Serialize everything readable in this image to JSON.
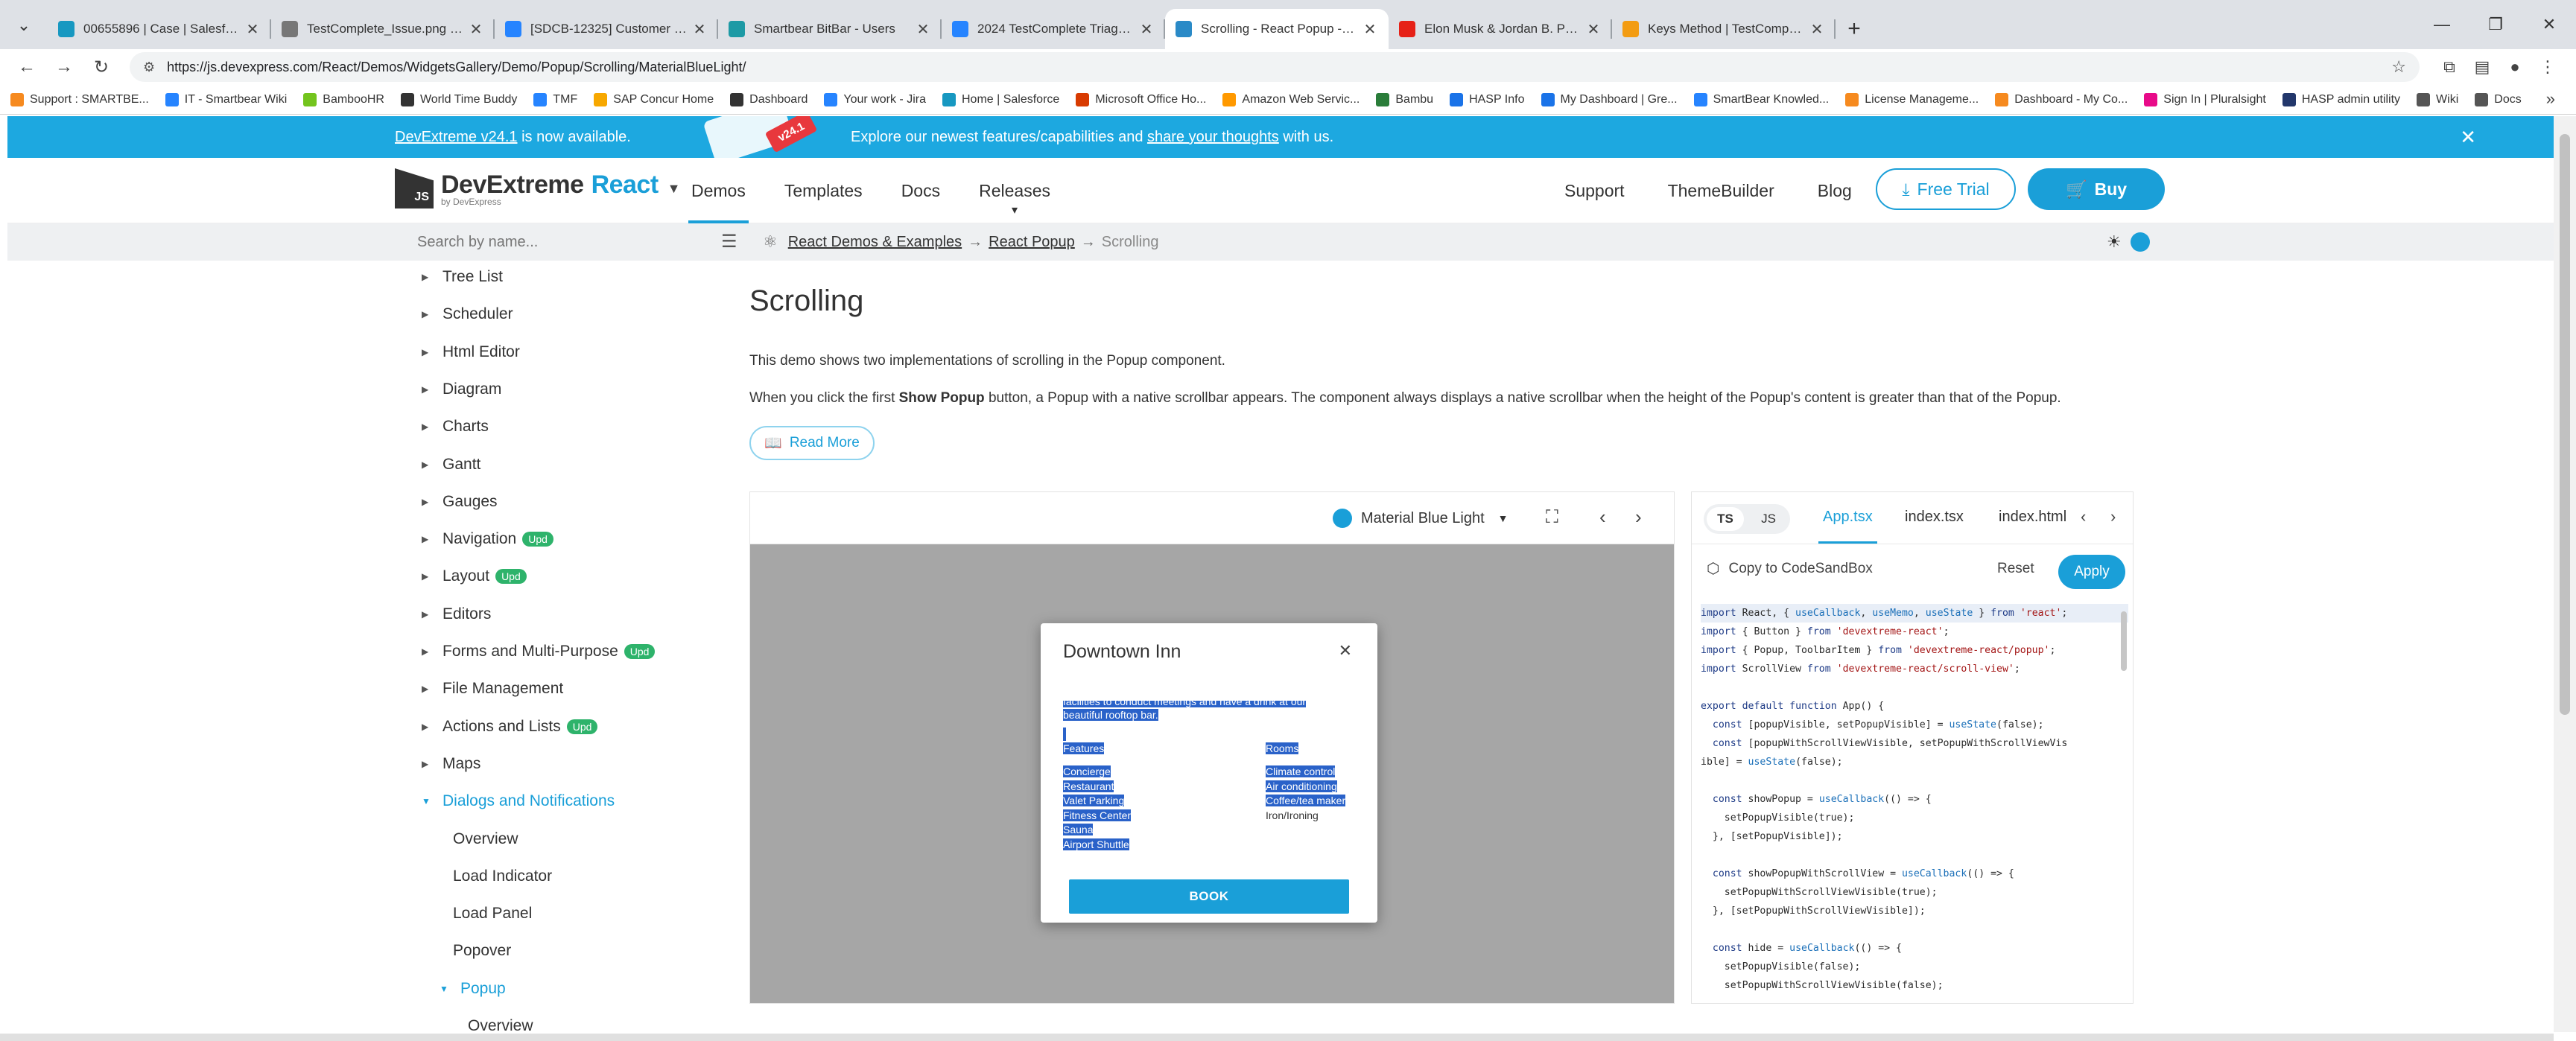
{
  "browser": {
    "tabs": [
      {
        "title": "00655896 | Case | Salesforce",
        "color": "#1798c1",
        "active": false
      },
      {
        "title": "TestComplete_Issue.png (3840×",
        "color": "#777777",
        "active": false
      },
      {
        "title": "[SDCB-12325] Customer is askin",
        "color": "#2684ff",
        "active": false
      },
      {
        "title": "Smartbear BitBar - Users",
        "color": "#1d9aa5",
        "active": false
      },
      {
        "title": "2024 TestComplete Triage - Con",
        "color": "#2684ff",
        "active": false
      },
      {
        "title": "Scrolling - React Popup - DevEx",
        "color": "#2a8ac7",
        "active": true
      },
      {
        "title": "Elon Musk & Jordan B. Peterson",
        "color": "#e62117",
        "active": false
      },
      {
        "title": "Keys Method | TestComplete Do",
        "color": "#f39c12",
        "active": false
      }
    ],
    "new_tab": "+",
    "url": "https://js.devexpress.com/React/Demos/WidgetsGallery/Demo/Popup/Scrolling/MaterialBlueLight/",
    "bookmarks": [
      {
        "label": "Support : SMARTBE...",
        "color": "#f68a1f"
      },
      {
        "label": "IT - Smartbear Wiki",
        "color": "#2684ff"
      },
      {
        "label": "BambooHR",
        "color": "#73c41d"
      },
      {
        "label": "World Time Buddy",
        "color": "#333333"
      },
      {
        "label": "TMF",
        "color": "#2684ff"
      },
      {
        "label": "SAP Concur Home",
        "color": "#f7a800"
      },
      {
        "label": "Dashboard",
        "color": "#333333"
      },
      {
        "label": "Your work - Jira",
        "color": "#2684ff"
      },
      {
        "label": "Home | Salesforce",
        "color": "#1798c1"
      },
      {
        "label": "Microsoft Office Ho...",
        "color": "#d83b01"
      },
      {
        "label": "Amazon Web Servic...",
        "color": "#ff9900"
      },
      {
        "label": "Bambu",
        "color": "#2a7d3a"
      },
      {
        "label": "HASP Info",
        "color": "#1a73e8"
      },
      {
        "label": "My Dashboard | Gre...",
        "color": "#1a73e8"
      },
      {
        "label": "SmartBear Knowled...",
        "color": "#2684ff"
      },
      {
        "label": "License Manageme...",
        "color": "#f68a1f"
      },
      {
        "label": "Dashboard - My Co...",
        "color": "#f68a1f"
      },
      {
        "label": "Sign In | Pluralsight",
        "color": "#e80a89"
      },
      {
        "label": "HASP admin utility",
        "color": "#22376b"
      },
      {
        "label": "Wiki",
        "color": "#555555"
      },
      {
        "label": "Docs",
        "color": "#555555"
      }
    ]
  },
  "announcement": {
    "version_link": "DevExtreme v24.1",
    "version_suffix": " is now available.",
    "badge": "v24.1",
    "message_prefix": "Explore our newest features/capabilities and ",
    "message_link": "share your thoughts",
    "message_suffix": " with us."
  },
  "header": {
    "logo_name": "DevExtreme",
    "logo_product": "React",
    "logo_byline": "by DevExpress",
    "logo_mark": "JS",
    "nav": [
      "Demos",
      "Templates",
      "Docs",
      "Releases"
    ],
    "right_nav": [
      "Support",
      "ThemeBuilder",
      "Blog"
    ],
    "free_trial": "Free Trial",
    "buy": "Buy"
  },
  "subbar": {
    "search_placeholder": "Search by name...",
    "breadcrumb": [
      "React Demos & Examples",
      "React Popup",
      "Scrolling"
    ]
  },
  "sidebar": {
    "items": [
      {
        "label": "Tree List",
        "badge": ""
      },
      {
        "label": "Scheduler",
        "badge": ""
      },
      {
        "label": "Html Editor",
        "badge": ""
      },
      {
        "label": "Diagram",
        "badge": ""
      },
      {
        "label": "Charts",
        "badge": ""
      },
      {
        "label": "Gantt",
        "badge": ""
      },
      {
        "label": "Gauges",
        "badge": ""
      },
      {
        "label": "Navigation",
        "badge": "Upd"
      },
      {
        "label": "Layout",
        "badge": "Upd"
      },
      {
        "label": "Editors",
        "badge": ""
      },
      {
        "label": "Forms and Multi-Purpose",
        "badge": "Upd"
      },
      {
        "label": "File Management",
        "badge": ""
      },
      {
        "label": "Actions and Lists",
        "badge": "Upd"
      },
      {
        "label": "Maps",
        "badge": ""
      },
      {
        "label": "Dialogs and Notifications",
        "badge": ""
      }
    ],
    "sub_items": [
      "Overview",
      "Load Indicator",
      "Load Panel",
      "Popover",
      "Popup"
    ],
    "sub_sub_items": [
      "Overview"
    ]
  },
  "content": {
    "title": "Scrolling",
    "paragraph1": "This demo shows two implementations of scrolling in the Popup component.",
    "paragraph2_prefix": "When you click the first ",
    "paragraph2_bold": "Show Popup",
    "paragraph2_suffix": " button, a Popup with a native scrollbar appears. The component always displays a native scrollbar when the height of the Popup's content is greater than that of the Popup.",
    "read_more": "Read More"
  },
  "demo": {
    "theme": "Material Blue Light",
    "popup": {
      "title": "Downtown Inn",
      "intro_line1": "facilities to conduct meetings and have a drink at our",
      "intro_line2": "beautiful rooftop bar.",
      "features_header": "Features",
      "rooms_header": "Rooms",
      "features": [
        "Concierge",
        "Restaurant",
        "Valet Parking",
        "Fitness Center",
        "Sauna",
        "Airport Shuttle"
      ],
      "rooms": [
        "Climate control",
        "Air conditioning",
        "Coffee/tea maker",
        "Iron/Ironing"
      ],
      "book": "BOOK"
    }
  },
  "code": {
    "lang_ts": "TS",
    "lang_js": "JS",
    "files": [
      "App.tsx",
      "index.tsx",
      "index.html"
    ],
    "copy_sandbox": "Copy to CodeSandBox",
    "reset": "Reset",
    "apply": "Apply",
    "lines": [
      "import React, { useCallback, useMemo, useState } from 'react';",
      "import { Button } from 'devextreme-react';",
      "import { Popup, ToolbarItem } from 'devextreme-react/popup';",
      "import ScrollView from 'devextreme-react/scroll-view';",
      "",
      "export default function App() {",
      "  const [popupVisible, setPopupVisible] = useState(false);",
      "  const [popupWithScrollViewVisible, setPopupWithScrollViewVis",
      "ible] = useState(false);",
      "",
      "  const showPopup = useCallback(() => {",
      "    setPopupVisible(true);",
      "  }, [setPopupVisible]);",
      "",
      "  const showPopupWithScrollView = useCallback(() => {",
      "    setPopupWithScrollViewVisible(true);",
      "  }, [setPopupWithScrollViewVisible]);",
      "",
      "  const hide = useCallback(() => {",
      "    setPopupVisible(false);",
      "    setPopupWithScrollViewVisible(false);"
    ]
  }
}
